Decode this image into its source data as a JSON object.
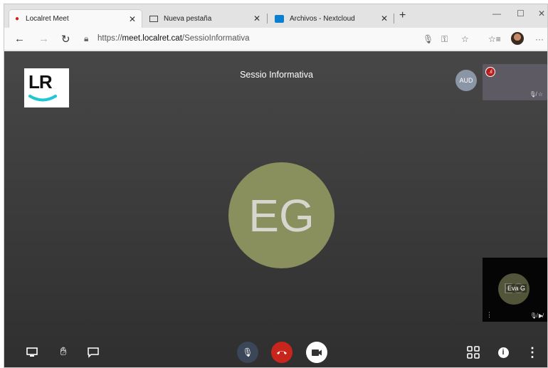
{
  "browser": {
    "tabs": [
      {
        "label": "Localret Meet",
        "active": true
      },
      {
        "label": "Nueva pestaña",
        "active": false
      },
      {
        "label": "Archivos - Nextcloud",
        "active": false
      }
    ],
    "url": {
      "scheme": "https://",
      "host": "meet.localret.cat",
      "path": "/SessioInformativa"
    }
  },
  "meeting": {
    "title": "Sessio Informativa",
    "logo_text": "LR",
    "main_initials": "EG",
    "audio_badge": "AUD",
    "self_view": {
      "initials": "EG",
      "name": "Eva G"
    }
  },
  "colors": {
    "avatar": "#8a8f5e",
    "hangup": "#c8261d",
    "mic": "#3b4658",
    "logo_accent": "#1fc6d4"
  }
}
